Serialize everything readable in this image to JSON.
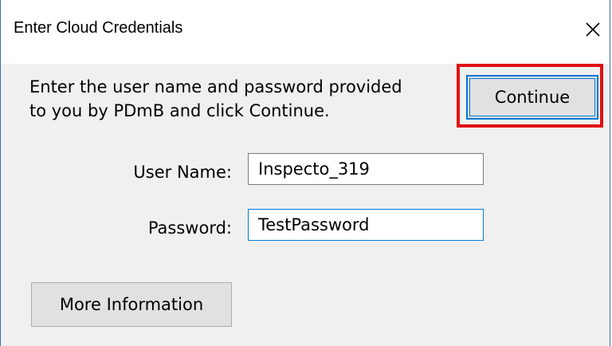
{
  "dialog": {
    "title": "Enter Cloud Credentials",
    "close_icon": "close-icon"
  },
  "instructions": {
    "line1": "Enter the user name and password provided",
    "line2": "to you by PDmB and click Continue."
  },
  "buttons": {
    "continue_label": "Continue",
    "more_info_label": "More Information"
  },
  "form": {
    "username_label": "User Name:",
    "username_value": "Inspecto_319",
    "password_label": "Password:",
    "password_value": "TestPassword"
  },
  "colors": {
    "highlight": "#e01010",
    "focus_accent": "#0078d7",
    "client_bg": "#f0f0f0"
  }
}
